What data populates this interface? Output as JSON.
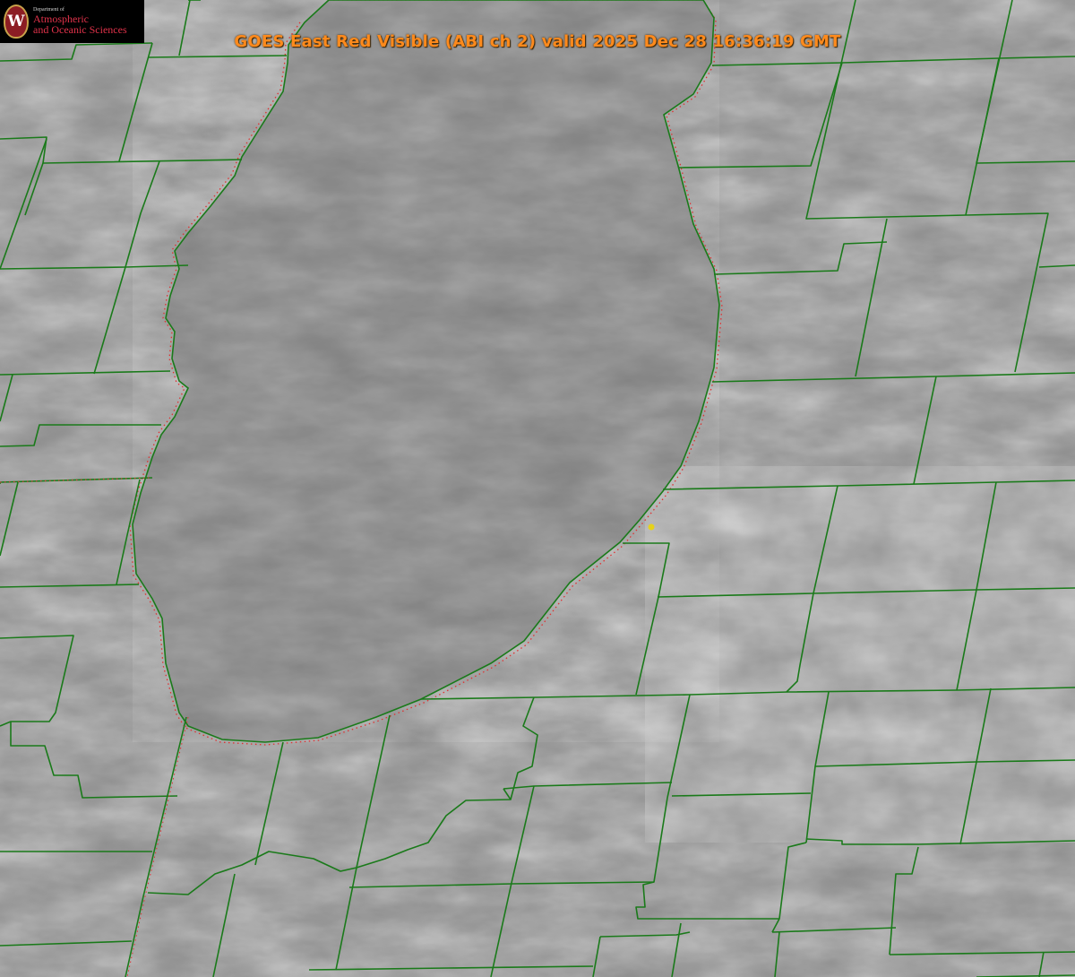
{
  "title": "GOES East Red Visible (ABI ch 2) valid 2025 Dec 28 16:36:19 GMT",
  "logo": {
    "dept": "Department of",
    "line1": "Atmospheric",
    "line2": "and Oceanic Sciences",
    "seal_letter": "W"
  },
  "colors": {
    "background_gray": "#8a8a8a",
    "lake_gray": "#7f7f7f",
    "county_lines": "#1a7a1a",
    "shoreline_dots": "#e03030",
    "title": "#ff8a1c",
    "marker": "#e6d21a"
  },
  "map": {
    "features": [
      "county-boundaries",
      "lake-shoreline",
      "state-boundary",
      "location-marker"
    ]
  }
}
